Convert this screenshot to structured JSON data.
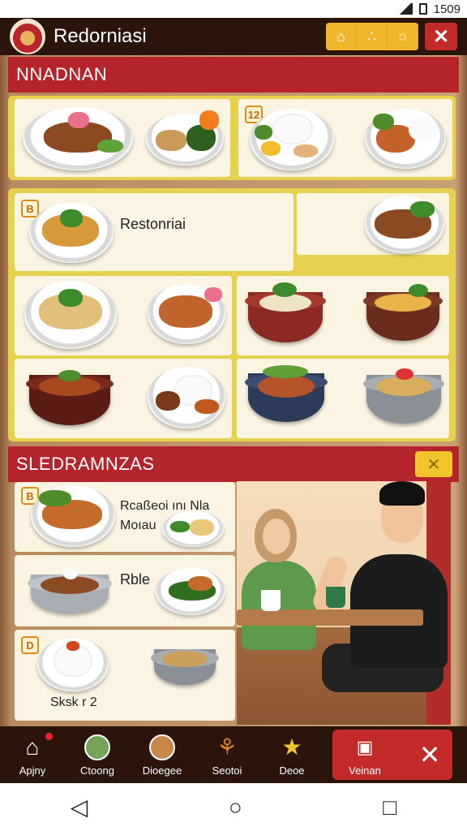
{
  "status": {
    "time": "1509"
  },
  "app": {
    "title": "Redorniasi"
  },
  "header_actions": [
    {
      "icon": "home-icon"
    },
    {
      "icon": "fork-icon"
    },
    {
      "icon": "circle-icon"
    }
  ],
  "sections": {
    "first_title": "NNADNAN",
    "second_title": "SLEDRAMNZAS"
  },
  "menu_cards": {
    "card1_badge": "12",
    "card2_badge": "B",
    "card2_label": "Restonriai"
  },
  "second_list": {
    "item1_badge": "B",
    "item1_label_line1": "Rcaßeoi ını Nla",
    "item1_label_line2": "Moıau",
    "item2_label": "Rble",
    "item3_badge": "D",
    "item3_label": "Sksk r 2"
  },
  "bottom_nav": [
    {
      "label": "Apjny",
      "icon": "home-icon"
    },
    {
      "label": "Ctoong",
      "icon": "avatar-icon"
    },
    {
      "label": "Dioegee",
      "icon": "avatar-icon"
    },
    {
      "label": "Seotoi",
      "icon": "goblet-icon"
    },
    {
      "label": "Deoe",
      "icon": "star-icon"
    },
    {
      "label": "Veinan",
      "icon": "camera-icon"
    },
    {
      "label": "",
      "icon": "close-icon"
    }
  ],
  "colors": {
    "brand_red": "#b5242a",
    "accent_yellow": "#f1b72c",
    "dark_bar": "#2b150b",
    "card_bg": "#fbf4e2"
  }
}
